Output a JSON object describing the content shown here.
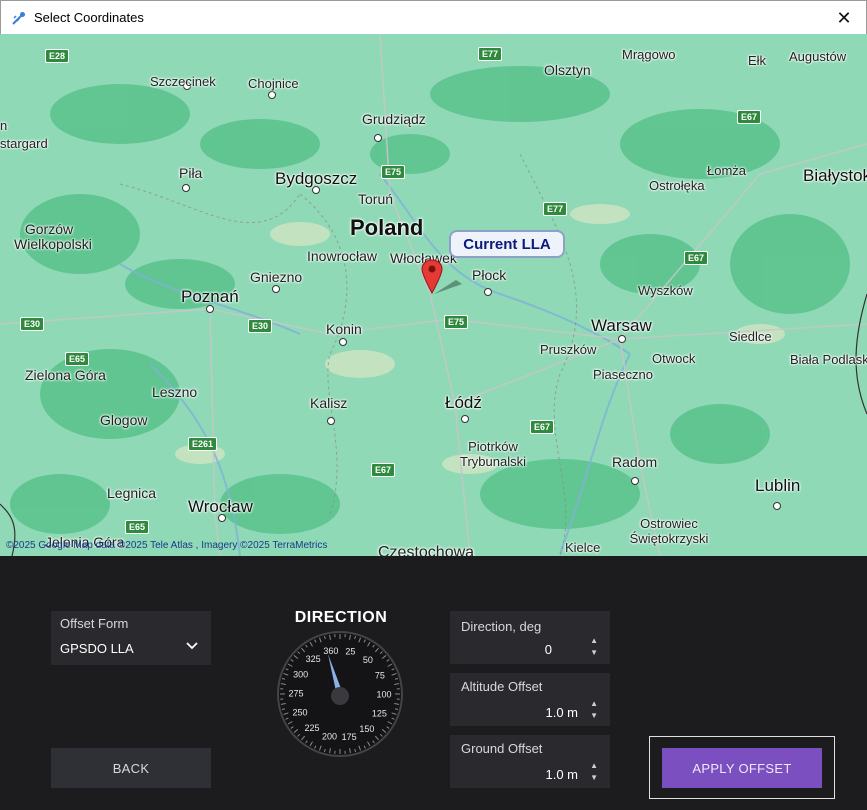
{
  "window": {
    "title": "Select Coordinates",
    "close_glyph": "✕"
  },
  "map": {
    "copyright": "©2025 Google   Map data ©2025 Tele Atlas , Imagery ©2025 TerraMetrics",
    "marker_label": "Current LLA",
    "cities": [
      "Olsztyn",
      "Mrągowo",
      "Ełk",
      "Augustów",
      "Szczecinek",
      "Chojnice",
      "Grudziądz",
      "Bydgoszcz",
      "Toruń",
      "Piła",
      "Poland",
      "Gorzów Wielkopolski",
      "Inowrocław",
      "Włocławek",
      "Płock",
      "Ostrołęka",
      "Łomża",
      "Białystok",
      "Gniezno",
      "Poznań",
      "Konin",
      "Wyszków",
      "Warsaw",
      "Pruszków",
      "Otwock",
      "Siedlce",
      "Biała Podlaska",
      "Piaseczno",
      "Zielona Góra",
      "Leszno",
      "Kalisz",
      "Łódź",
      "Glogow",
      "Piotrków Trybunalski",
      "Radom",
      "Legnica",
      "Wrocław",
      "Lublin",
      "Ostrowiec Świętokrzyski",
      "Jelenia Góra",
      "Kielce",
      "Częstochowa",
      "stargard",
      "n"
    ],
    "highways": [
      "E28",
      "E77",
      "E67",
      "E75",
      "E77",
      "E30",
      "E30",
      "E65",
      "E67",
      "E75",
      "E261",
      "E67",
      "E65",
      "E67"
    ]
  },
  "controls": {
    "offset_form": {
      "label": "Offset Form",
      "value": "GPSDO LLA"
    },
    "direction_title": "DIRECTION",
    "dial_labels": [
      "360",
      "25",
      "50",
      "75",
      "100",
      "125",
      "150",
      "175",
      "200",
      "225",
      "250",
      "275",
      "300",
      "325"
    ],
    "direction_deg": {
      "label": "Direction, deg",
      "value": "0"
    },
    "altitude_offset": {
      "label": "Altitude Offset",
      "value": "1.0 m"
    },
    "ground_offset": {
      "label": "Ground Offset",
      "value": "1.0 m"
    },
    "back_button": "BACK",
    "apply_button": "APPLY OFFSET"
  },
  "colors": {
    "accent": "#7b4fbf",
    "panel_bg": "#1c1c1f",
    "field_bg": "#2a2a2e",
    "map_land": "#8fd9b6",
    "map_forest": "#5cc38e"
  }
}
